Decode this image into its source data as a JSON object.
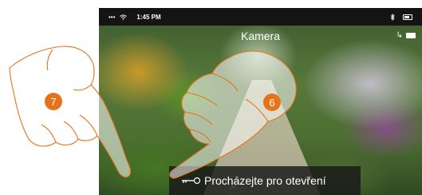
{
  "status_bar": {
    "signal": "•••",
    "wifi_icon": "wifi-icon",
    "time": "1:45 PM",
    "bluetooth_icon": "bluetooth-icon",
    "battery_icon": "battery-icon"
  },
  "header": {
    "title": "Kamera",
    "camera_icons": "camera-switch-icon"
  },
  "controls": {
    "mute_icon": "microphone-mute-icon",
    "unlock_label": "Procházejte pro otevření",
    "unlock_icon": "key-icon"
  },
  "callouts": {
    "left": "7",
    "right": "6"
  },
  "colors": {
    "callout": "#e8721c",
    "hand_outline": "#e8721c",
    "bar": "#191919"
  }
}
